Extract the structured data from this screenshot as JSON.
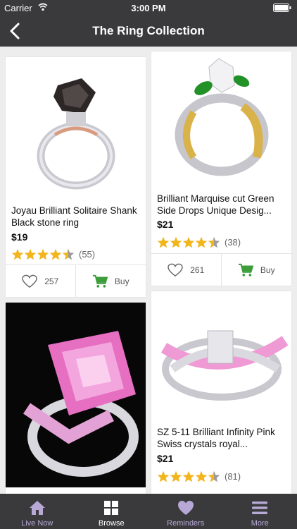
{
  "status_bar": {
    "carrier": "Carrier",
    "time": "3:00 PM"
  },
  "navbar": {
    "title": "The Ring Collection"
  },
  "products": [
    {
      "name": "Joyau Brilliant Solitaire Shank Black stone ring",
      "price": "$19",
      "rating": 4.5,
      "reviews": "(55)",
      "likes": "257",
      "buy_label": "Buy"
    },
    {
      "name": "Brilliant Marquise cut Green Side Drops Unique Desig...",
      "price": "$21",
      "rating": 4.5,
      "reviews": "(38)",
      "likes": "261",
      "buy_label": "Buy"
    },
    {
      "name": "SZ 5-11  Brilliant Infinity Pink Swiss crystals royal...",
      "price": "$21",
      "rating": 4.5,
      "reviews": "(81)"
    }
  ],
  "tabs": [
    {
      "label": "Live Now",
      "icon": "house-icon"
    },
    {
      "label": "Browse",
      "icon": "grid-icon"
    },
    {
      "label": "Reminders",
      "icon": "heart-icon"
    },
    {
      "label": "More",
      "icon": "menu-icon"
    }
  ],
  "colors": {
    "bar": "#3a3a3c",
    "star": "#f2b51c",
    "cart": "#3c9d3a",
    "tab_inactive": "#b7a8d6"
  }
}
